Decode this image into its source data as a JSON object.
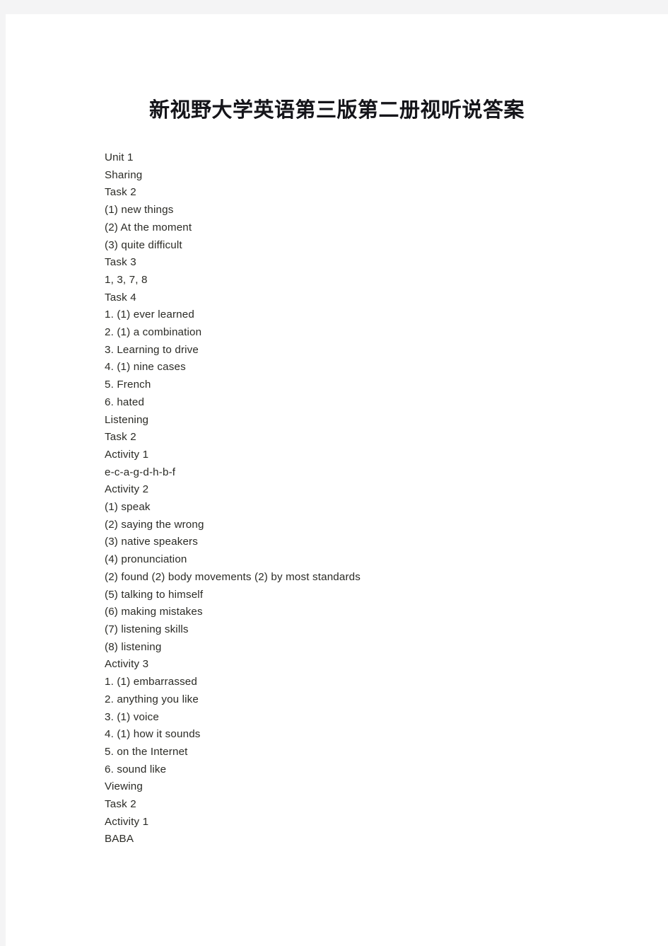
{
  "document": {
    "title": "新视野大学英语第三版第二册视听说答案",
    "page_background": "#ffffff",
    "frame_background": "#f4f4f5",
    "title_color": "#15151a",
    "body_text_color": "#2b2b26",
    "lines": [
      "Unit 1",
      "Sharing",
      "Task 2",
      "(1) new things",
      "(2) At the moment",
      "(3) quite difficult",
      "Task 3",
      "1, 3, 7, 8",
      "Task 4",
      "1. (1) ever learned",
      "2. (1) a combination",
      "3. Learning to drive",
      "4. (1) nine cases",
      "5. French",
      "6. hated",
      "Listening",
      "Task 2",
      "Activity 1",
      "e-c-a-g-d-h-b-f",
      "Activity 2",
      "(1) speak",
      "(2) saying the wrong",
      "(3) native speakers",
      "(4) pronunciation",
      "(2) found (2) body movements (2) by most standards",
      "(5) talking to himself",
      "(6) making mistakes",
      "(7) listening skills",
      "(8) listening",
      "Activity 3",
      "1. (1) embarrassed",
      "2. anything you like",
      "3. (1) voice",
      "4. (1) how it sounds",
      "5. on the Internet",
      "6. sound like",
      "Viewing",
      "Task 2",
      "Activity 1",
      "BABA"
    ]
  }
}
